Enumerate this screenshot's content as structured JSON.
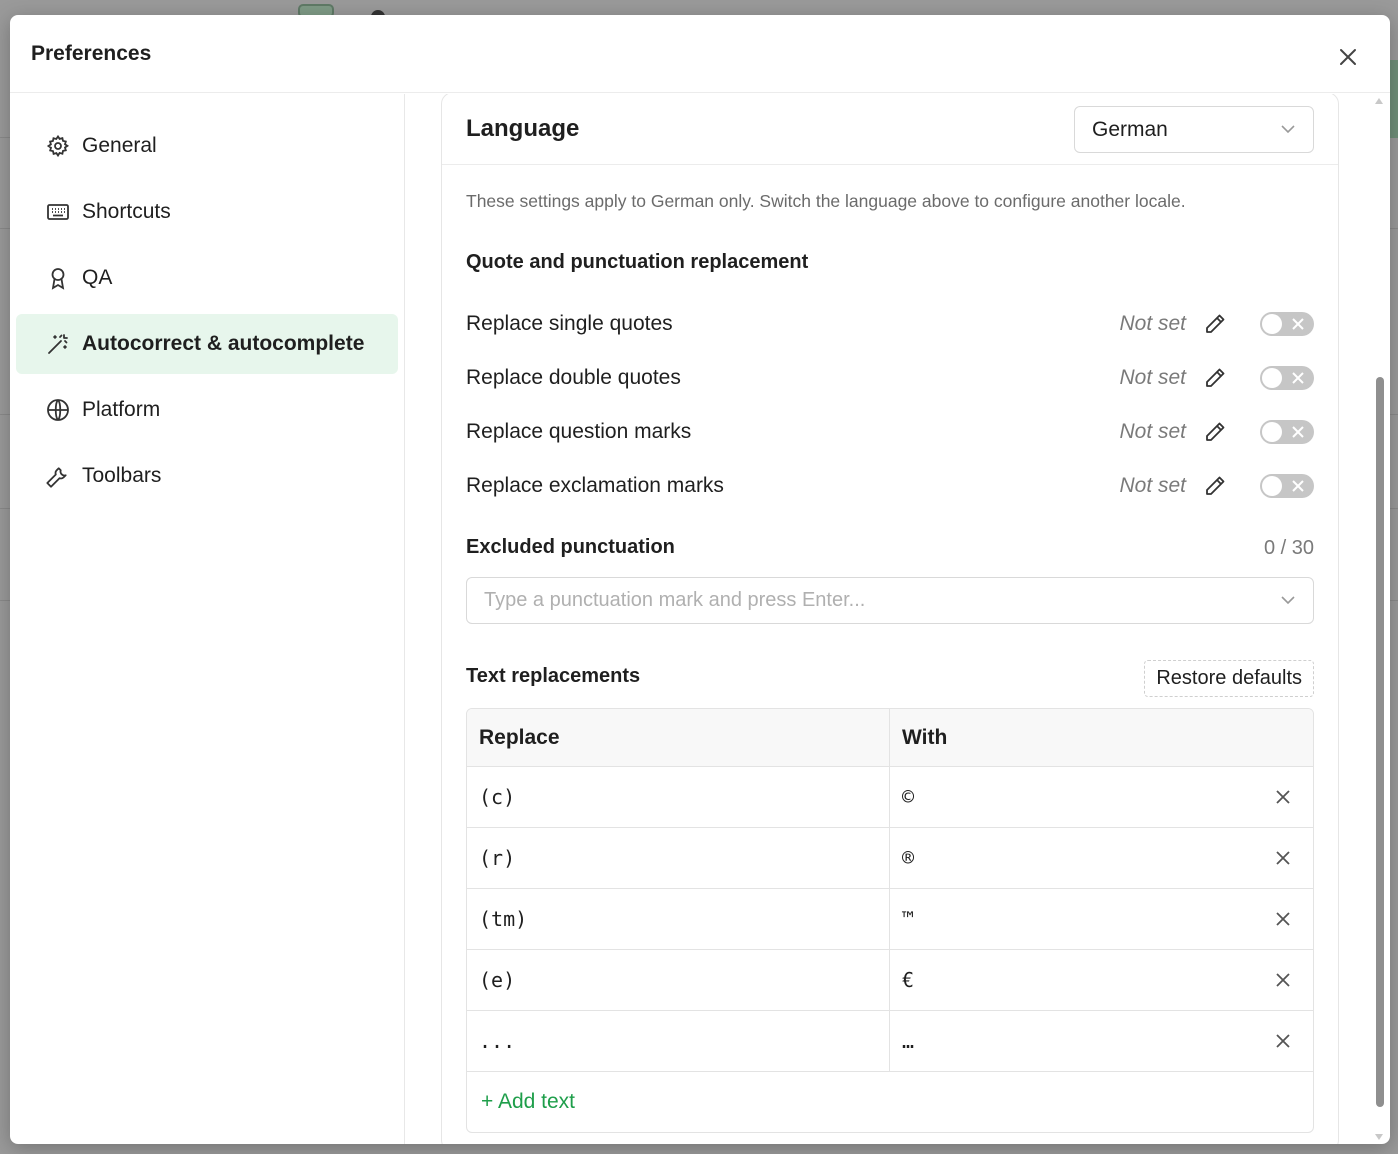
{
  "modal": {
    "title": "Preferences"
  },
  "sidebar": {
    "items": [
      {
        "label": "General",
        "icon": "gear-icon"
      },
      {
        "label": "Shortcuts",
        "icon": "keyboard-icon"
      },
      {
        "label": "QA",
        "icon": "award-icon"
      },
      {
        "label": "Autocorrect & autocomplete",
        "icon": "magic-wand-icon",
        "active": true
      },
      {
        "label": "Platform",
        "icon": "globe-icon"
      },
      {
        "label": "Toolbars",
        "icon": "wrench-icon"
      }
    ]
  },
  "language": {
    "title": "Language",
    "selected": "German",
    "hint": "These settings apply to German only. Switch the language above to configure another locale."
  },
  "quotes": {
    "title": "Quote and punctuation replacement",
    "rows": [
      {
        "label": "Replace single quotes",
        "value": "Not set",
        "enabled": false
      },
      {
        "label": "Replace double quotes",
        "value": "Not set",
        "enabled": false
      },
      {
        "label": "Replace question marks",
        "value": "Not set",
        "enabled": false
      },
      {
        "label": "Replace exclamation marks",
        "value": "Not set",
        "enabled": false
      }
    ]
  },
  "excluded": {
    "title": "Excluded punctuation",
    "count": "0 / 30",
    "placeholder": "Type a punctuation mark and press Enter..."
  },
  "replacements": {
    "title": "Text replacements",
    "restore_label": "Restore defaults",
    "headers": {
      "replace": "Replace",
      "with": "With"
    },
    "rows": [
      {
        "replace": "(c)",
        "with": "©"
      },
      {
        "replace": "(r)",
        "with": "®"
      },
      {
        "replace": "(tm)",
        "with": "™"
      },
      {
        "replace": "(e)",
        "with": "€"
      },
      {
        "replace": "...",
        "with": "…"
      }
    ],
    "add_label": "+ Add text"
  },
  "colors": {
    "accent": "#1e9e4a",
    "active_bg": "#e7f6ec",
    "toggle_off": "#c6c6c6"
  }
}
